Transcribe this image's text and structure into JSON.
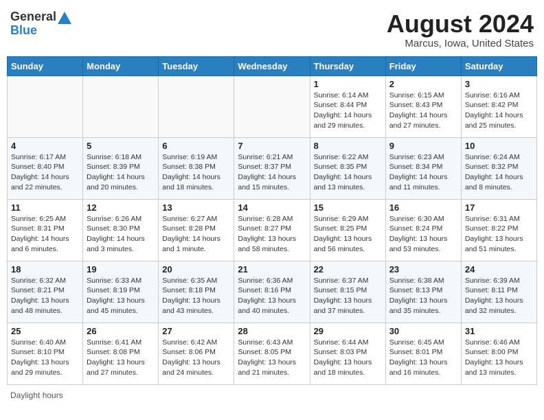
{
  "header": {
    "logo_general": "General",
    "logo_blue": "Blue",
    "month_year": "August 2024",
    "location": "Marcus, Iowa, United States"
  },
  "footer": {
    "label": "Daylight hours"
  },
  "weekdays": [
    "Sunday",
    "Monday",
    "Tuesday",
    "Wednesday",
    "Thursday",
    "Friday",
    "Saturday"
  ],
  "weeks": [
    [
      {
        "day": "",
        "info": ""
      },
      {
        "day": "",
        "info": ""
      },
      {
        "day": "",
        "info": ""
      },
      {
        "day": "",
        "info": ""
      },
      {
        "day": "1",
        "info": "Sunrise: 6:14 AM\nSunset: 8:44 PM\nDaylight: 14 hours and 29 minutes."
      },
      {
        "day": "2",
        "info": "Sunrise: 6:15 AM\nSunset: 8:43 PM\nDaylight: 14 hours and 27 minutes."
      },
      {
        "day": "3",
        "info": "Sunrise: 6:16 AM\nSunset: 8:42 PM\nDaylight: 14 hours and 25 minutes."
      }
    ],
    [
      {
        "day": "4",
        "info": "Sunrise: 6:17 AM\nSunset: 8:40 PM\nDaylight: 14 hours and 22 minutes."
      },
      {
        "day": "5",
        "info": "Sunrise: 6:18 AM\nSunset: 8:39 PM\nDaylight: 14 hours and 20 minutes."
      },
      {
        "day": "6",
        "info": "Sunrise: 6:19 AM\nSunset: 8:38 PM\nDaylight: 14 hours and 18 minutes."
      },
      {
        "day": "7",
        "info": "Sunrise: 6:21 AM\nSunset: 8:37 PM\nDaylight: 14 hours and 15 minutes."
      },
      {
        "day": "8",
        "info": "Sunrise: 6:22 AM\nSunset: 8:35 PM\nDaylight: 14 hours and 13 minutes."
      },
      {
        "day": "9",
        "info": "Sunrise: 6:23 AM\nSunset: 8:34 PM\nDaylight: 14 hours and 11 minutes."
      },
      {
        "day": "10",
        "info": "Sunrise: 6:24 AM\nSunset: 8:32 PM\nDaylight: 14 hours and 8 minutes."
      }
    ],
    [
      {
        "day": "11",
        "info": "Sunrise: 6:25 AM\nSunset: 8:31 PM\nDaylight: 14 hours and 6 minutes."
      },
      {
        "day": "12",
        "info": "Sunrise: 6:26 AM\nSunset: 8:30 PM\nDaylight: 14 hours and 3 minutes."
      },
      {
        "day": "13",
        "info": "Sunrise: 6:27 AM\nSunset: 8:28 PM\nDaylight: 14 hours and 1 minute."
      },
      {
        "day": "14",
        "info": "Sunrise: 6:28 AM\nSunset: 8:27 PM\nDaylight: 13 hours and 58 minutes."
      },
      {
        "day": "15",
        "info": "Sunrise: 6:29 AM\nSunset: 8:25 PM\nDaylight: 13 hours and 56 minutes."
      },
      {
        "day": "16",
        "info": "Sunrise: 6:30 AM\nSunset: 8:24 PM\nDaylight: 13 hours and 53 minutes."
      },
      {
        "day": "17",
        "info": "Sunrise: 6:31 AM\nSunset: 8:22 PM\nDaylight: 13 hours and 51 minutes."
      }
    ],
    [
      {
        "day": "18",
        "info": "Sunrise: 6:32 AM\nSunset: 8:21 PM\nDaylight: 13 hours and 48 minutes."
      },
      {
        "day": "19",
        "info": "Sunrise: 6:33 AM\nSunset: 8:19 PM\nDaylight: 13 hours and 45 minutes."
      },
      {
        "day": "20",
        "info": "Sunrise: 6:35 AM\nSunset: 8:18 PM\nDaylight: 13 hours and 43 minutes."
      },
      {
        "day": "21",
        "info": "Sunrise: 6:36 AM\nSunset: 8:16 PM\nDaylight: 13 hours and 40 minutes."
      },
      {
        "day": "22",
        "info": "Sunrise: 6:37 AM\nSunset: 8:15 PM\nDaylight: 13 hours and 37 minutes."
      },
      {
        "day": "23",
        "info": "Sunrise: 6:38 AM\nSunset: 8:13 PM\nDaylight: 13 hours and 35 minutes."
      },
      {
        "day": "24",
        "info": "Sunrise: 6:39 AM\nSunset: 8:11 PM\nDaylight: 13 hours and 32 minutes."
      }
    ],
    [
      {
        "day": "25",
        "info": "Sunrise: 6:40 AM\nSunset: 8:10 PM\nDaylight: 13 hours and 29 minutes."
      },
      {
        "day": "26",
        "info": "Sunrise: 6:41 AM\nSunset: 8:08 PM\nDaylight: 13 hours and 27 minutes."
      },
      {
        "day": "27",
        "info": "Sunrise: 6:42 AM\nSunset: 8:06 PM\nDaylight: 13 hours and 24 minutes."
      },
      {
        "day": "28",
        "info": "Sunrise: 6:43 AM\nSunset: 8:05 PM\nDaylight: 13 hours and 21 minutes."
      },
      {
        "day": "29",
        "info": "Sunrise: 6:44 AM\nSunset: 8:03 PM\nDaylight: 13 hours and 18 minutes."
      },
      {
        "day": "30",
        "info": "Sunrise: 6:45 AM\nSunset: 8:01 PM\nDaylight: 13 hours and 16 minutes."
      },
      {
        "day": "31",
        "info": "Sunrise: 6:46 AM\nSunset: 8:00 PM\nDaylight: 13 hours and 13 minutes."
      }
    ]
  ]
}
